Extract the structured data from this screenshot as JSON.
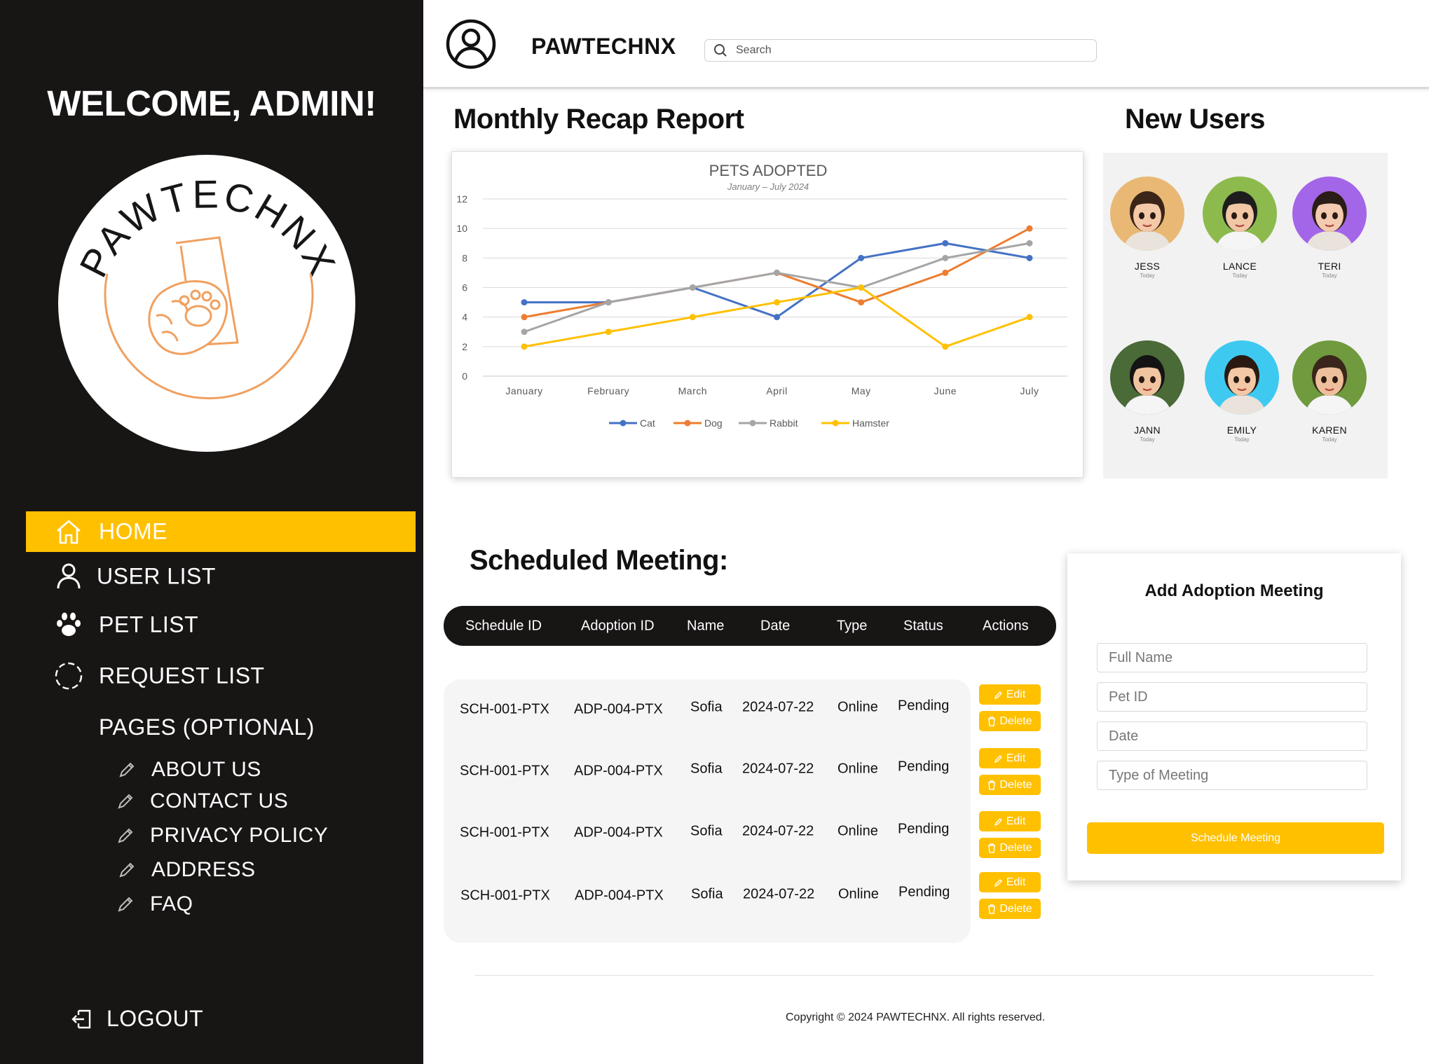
{
  "sidebar": {
    "welcome": "WELCOME, ADMIN!",
    "logo_text": "PAWTECHNX",
    "nav": [
      {
        "label": "HOME",
        "icon": "home-icon",
        "active": true
      },
      {
        "label": "USER LIST",
        "icon": "user-icon",
        "active": false
      },
      {
        "label": "PET LIST",
        "icon": "paw-icon",
        "active": false
      },
      {
        "label": "REQUEST LIST",
        "icon": "dashed-circle-icon",
        "active": false
      }
    ],
    "pages_heading": "PAGES (OPTIONAL)",
    "pages": [
      {
        "label": "ABOUT US",
        "icon": "pencil-icon"
      },
      {
        "label": "CONTACT US",
        "icon": "pencil-icon"
      },
      {
        "label": "PRIVACY POLICY",
        "icon": "pencil-icon"
      },
      {
        "label": "ADDRESS",
        "icon": "pencil-icon"
      },
      {
        "label": "FAQ",
        "icon": "pencil-icon"
      }
    ],
    "logout": "LOGOUT"
  },
  "topbar": {
    "brand": "PAWTECHNX",
    "search_placeholder": "Search"
  },
  "report": {
    "heading": "Monthly Recap Report"
  },
  "chart_data": {
    "type": "line",
    "title": "PETS ADOPTED",
    "subtitle": "January – July 2024",
    "categories": [
      "January",
      "February",
      "March",
      "April",
      "May",
      "June",
      "July"
    ],
    "ylim": [
      0,
      12
    ],
    "yticks": [
      0,
      2,
      4,
      6,
      8,
      10,
      12
    ],
    "grid": true,
    "legend": "bottom",
    "series": [
      {
        "name": "Cat",
        "color": "#4472c4",
        "values": [
          5,
          5,
          6,
          4,
          8,
          9,
          8
        ]
      },
      {
        "name": "Dog",
        "color": "#ed7d31",
        "values": [
          4,
          5,
          6,
          7,
          5,
          7,
          10
        ]
      },
      {
        "name": "Rabbit",
        "color": "#a5a5a5",
        "values": [
          3,
          5,
          6,
          7,
          6,
          8,
          9
        ]
      },
      {
        "name": "Hamster",
        "color": "#ffc000",
        "values": [
          2,
          3,
          4,
          5,
          6,
          2,
          4
        ]
      }
    ]
  },
  "new_users": {
    "heading": "New Users",
    "users": [
      {
        "name": "JESS",
        "date": "Today",
        "bg": "#e8b874"
      },
      {
        "name": "LANCE",
        "date": "Today",
        "bg": "#8dba4c"
      },
      {
        "name": "TERI",
        "date": "Today",
        "bg": "#a366e8"
      },
      {
        "name": "JANN",
        "date": "Today",
        "bg": "#4a6a38"
      },
      {
        "name": "EMILY",
        "date": "Today",
        "bg": "#3ecaf0"
      },
      {
        "name": "KAREN",
        "date": "Today",
        "bg": "#6f9a3d"
      }
    ]
  },
  "meetings": {
    "heading": "Scheduled Meeting:",
    "columns": [
      "Schedule ID",
      "Adoption ID",
      "Name",
      "Date",
      "Type",
      "Status",
      "Actions"
    ],
    "rows": [
      {
        "schedule_id": "SCH-001-PTX",
        "adoption_id": "ADP-004-PTX",
        "name": "Sofia",
        "date": "2024-07-22",
        "type": "Online",
        "status": "Pending"
      },
      {
        "schedule_id": "SCH-001-PTX",
        "adoption_id": "ADP-004-PTX",
        "name": "Sofia",
        "date": "2024-07-22",
        "type": "Online",
        "status": "Pending"
      },
      {
        "schedule_id": "SCH-001-PTX",
        "adoption_id": "ADP-004-PTX",
        "name": "Sofia",
        "date": "2024-07-22",
        "type": "Online",
        "status": "Pending"
      },
      {
        "schedule_id": "SCH-001-PTX",
        "adoption_id": "ADP-004-PTX",
        "name": "Sofia",
        "date": "2024-07-22",
        "type": "Online",
        "status": "Pending"
      }
    ],
    "edit_label": "Edit",
    "delete_label": "Delete"
  },
  "form": {
    "title": "Add Adoption Meeting",
    "fields": [
      {
        "placeholder": "Full Name",
        "value": ""
      },
      {
        "placeholder": "Pet ID",
        "value": ""
      },
      {
        "placeholder": "Date",
        "value": ""
      },
      {
        "placeholder": "Type of Meeting",
        "value": ""
      }
    ],
    "submit_label": "Schedule Meeting"
  },
  "footer": {
    "copyright": "Copyright © 2024 PAWTECHNX. All rights reserved."
  },
  "colors": {
    "accent": "#ffc000",
    "sidebar_bg": "#181515",
    "logo_stroke": "#f0a060"
  }
}
